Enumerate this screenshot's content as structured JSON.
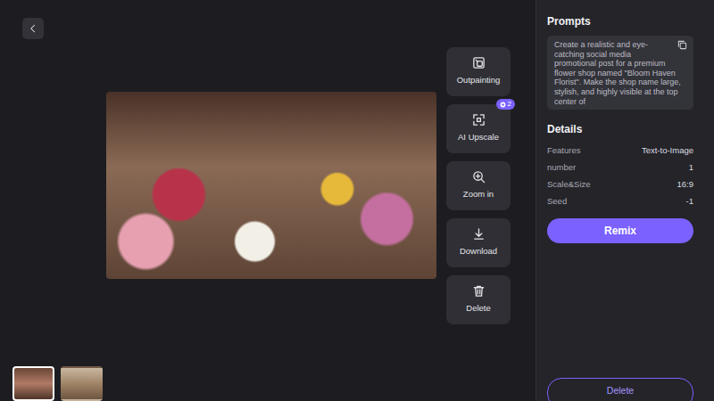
{
  "tools": [
    {
      "label": "Outpainting"
    },
    {
      "label": "AI Upscale",
      "badge": "2"
    },
    {
      "label": "Zoom in"
    },
    {
      "label": "Download"
    },
    {
      "label": "Delete"
    }
  ],
  "thumbnails": [
    {
      "selected": true
    },
    {
      "selected": false
    }
  ],
  "panel": {
    "prompts_title": "Prompts",
    "prompt": "Create a realistic and eye-catching social media promotional post for a premium flower shop named \"Bloom Haven Florist\". Make the shop name large, stylish, and highly visible at the top center of",
    "details_title": "Details",
    "details": [
      {
        "label": "Features",
        "value": "Text-to-Image"
      },
      {
        "label": "number",
        "value": "1"
      },
      {
        "label": "Scale&Size",
        "value": "16:9"
      },
      {
        "label": "Seed",
        "value": "-1"
      }
    ],
    "remix": "Remix",
    "delete": "Delete"
  }
}
